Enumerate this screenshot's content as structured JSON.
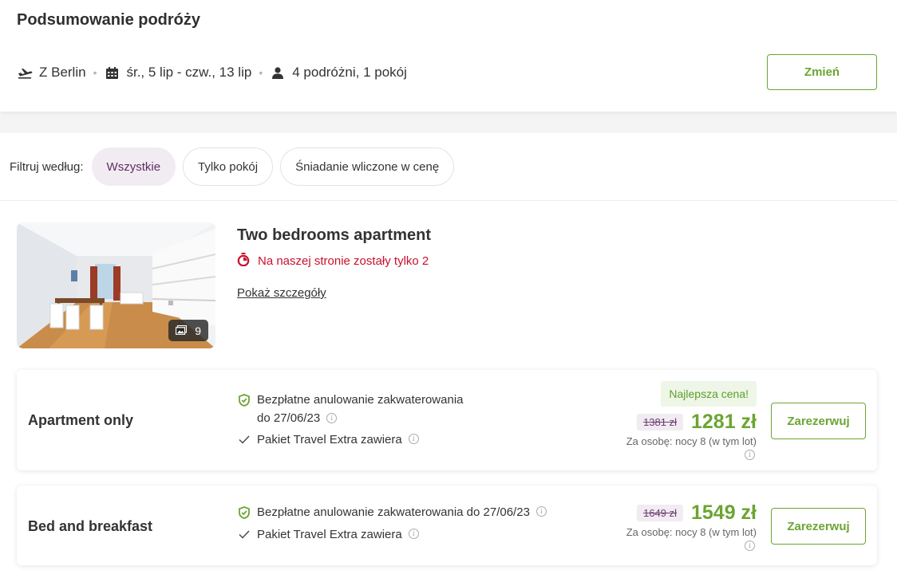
{
  "summary": {
    "title": "Podsumowanie podróży",
    "origin": "Z Berlin",
    "dates": "śr., 5 lip - czw., 13 lip",
    "travelers": "4 podróżni, 1 pokój",
    "separator": "•",
    "change_label": "Zmień",
    "icons": {
      "origin": "plane-departure-icon",
      "dates": "calendar-icon",
      "travelers": "person-icon"
    }
  },
  "filters": {
    "label": "Filtruj według:",
    "options": [
      "Wszystkie",
      "Tylko pokój",
      "Śniadanie wliczone w cenę"
    ],
    "selected": "Wszystkie"
  },
  "room": {
    "title": "Two bedrooms apartment",
    "urgency": "Na naszej stronie zostały tylko 2",
    "details_link": "Pokaż szczegóły",
    "photo_count": "9"
  },
  "offers": [
    {
      "name": "Apartment only",
      "cancellation_line1": "Bezpłatne anulowanie zakwaterowania",
      "cancellation_line2": "do 27/06/23",
      "package": "Pakiet Travel Extra zawiera",
      "best_badge": "Najlepsza cena!",
      "old_price": "1381 zł",
      "new_price": "1281 zł",
      "per_person": "Za osobę: nocy 8 (w tym lot)",
      "book_label": "Zarezerwuj"
    },
    {
      "name": "Bed and breakfast",
      "cancellation": "Bezpłatne anulowanie zakwaterowania do 27/06/23",
      "package": "Pakiet Travel Extra zawiera",
      "old_price": "1649 zł",
      "new_price": "1549 zł",
      "per_person": "Za osobę: nocy 8 (w tym lot)",
      "book_label": "Zarezerwuj"
    }
  ],
  "colors": {
    "accent_green": "#6ba532",
    "urgency_red": "#c8102e",
    "chip_active": "#f1ebf2",
    "plum": "#6c3e71"
  }
}
